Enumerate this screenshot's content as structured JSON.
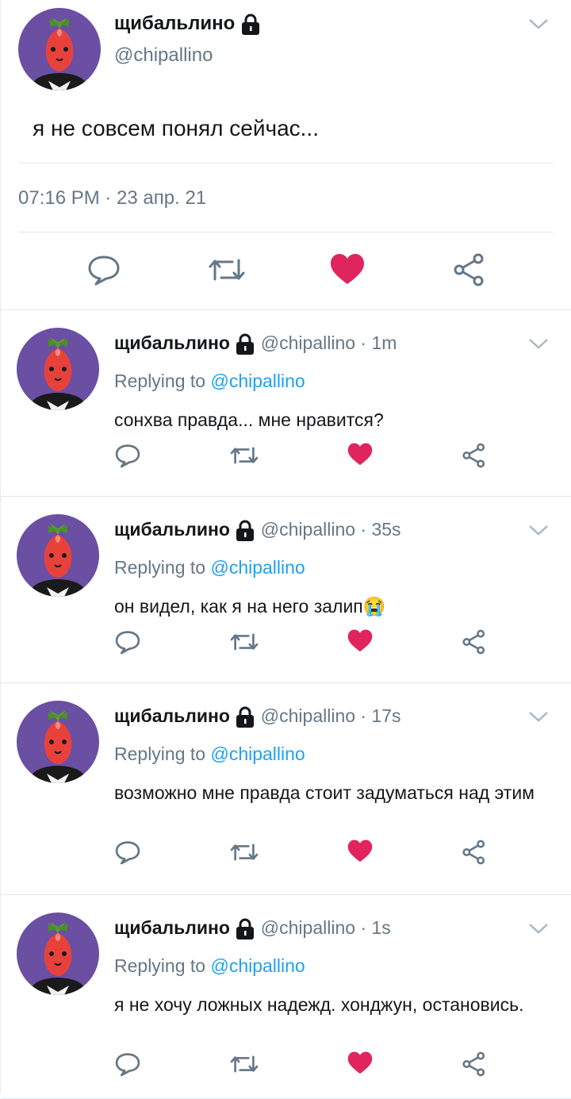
{
  "main_tweet": {
    "display_name": "щибальлино",
    "handle": "@chipallino",
    "text": "я не совсем понял сейчас...",
    "timestamp": "07:16 PM · 23 апр. 21",
    "liked": true
  },
  "replies": [
    {
      "display_name": "щибальлино",
      "handle_time": "@chipallino · 1m",
      "replying_prefix": "Replying to ",
      "replying_to": "@chipallino",
      "text": "сонхва правда... мне нравится?",
      "liked": true
    },
    {
      "display_name": "щибальлино",
      "handle_time": "@chipallino · 35s",
      "replying_prefix": "Replying to ",
      "replying_to": "@chipallino",
      "text": "он видел, как я на него залип😭",
      "liked": true
    },
    {
      "display_name": "щибальлино",
      "handle_time": "@chipallino · 17s",
      "replying_prefix": "Replying to ",
      "replying_to": "@chipallino",
      "text": "возможно мне правда стоит задуматься над этим",
      "liked": true
    },
    {
      "display_name": "щибальлино",
      "handle_time": "@chipallino · 1s",
      "replying_prefix": "Replying to ",
      "replying_to": "@chipallino",
      "text": "я не хочу ложных надежд. хонджун, остановись.",
      "liked": true
    }
  ],
  "colors": {
    "like": "#e0245e",
    "mention": "#1da1f2",
    "secondary": "#657786",
    "avatar_bg": "#6a4fa3"
  },
  "icons": [
    "lock-icon",
    "chevron-down-icon",
    "reply-icon",
    "retweet-icon",
    "like-icon",
    "share-icon"
  ]
}
